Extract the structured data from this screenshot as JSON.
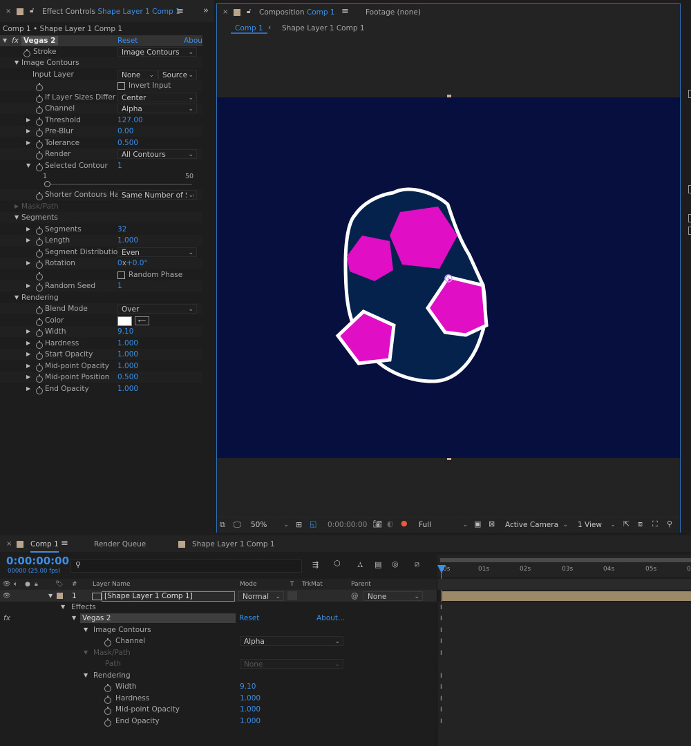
{
  "effect_panel": {
    "tab_title": "Effect Controls",
    "tab_layer": "Shape Layer 1 Comp 1",
    "breadcrumb": "Comp 1 • Shape Layer 1 Comp 1",
    "effect_name": "Vegas 2",
    "reset": "Reset",
    "about": "Abou",
    "rows": {
      "stroke": {
        "label": "Stroke",
        "value": "Image Contours"
      },
      "image_contours": "Image Contours",
      "input_layer": {
        "label": "Input Layer",
        "value": "None",
        "value2": "Source"
      },
      "invert_input": "Invert Input",
      "if_layer_sizes": {
        "label": "If Layer Sizes Differ",
        "value": "Center"
      },
      "channel": {
        "label": "Channel",
        "value": "Alpha"
      },
      "threshold": {
        "label": "Threshold",
        "value": "127.00"
      },
      "pre_blur": {
        "label": "Pre-Blur",
        "value": "0.00"
      },
      "tolerance": {
        "label": "Tolerance",
        "value": "0.500"
      },
      "render": {
        "label": "Render",
        "value": "All Contours"
      },
      "selected_contour": {
        "label": "Selected Contour",
        "value": "1",
        "slider_min": "1",
        "slider_max": "50"
      },
      "shorter_contours": {
        "label": "Shorter Contours Ha",
        "value": "Same Number of Se"
      },
      "mask_path": "Mask/Path",
      "segments_group": "Segments",
      "segments": {
        "label": "Segments",
        "value": "32"
      },
      "length": {
        "label": "Length",
        "value": "1.000"
      },
      "segment_distribution": {
        "label": "Segment Distribution",
        "value": "Even"
      },
      "rotation": {
        "label": "Rotation",
        "value_rev": "0",
        "value_x": "x",
        "value_deg": "+0.0°"
      },
      "random_phase": "Random Phase",
      "random_seed": {
        "label": "Random Seed",
        "value": "1"
      },
      "rendering_group": "Rendering",
      "blend_mode": {
        "label": "Blend Mode",
        "value": "Over"
      },
      "color": {
        "label": "Color"
      },
      "width": {
        "label": "Width",
        "value": "9.10"
      },
      "hardness": {
        "label": "Hardness",
        "value": "1.000"
      },
      "start_opacity": {
        "label": "Start Opacity",
        "value": "1.000"
      },
      "midpoint_opacity": {
        "label": "Mid-point Opacity",
        "value": "1.000"
      },
      "midpoint_position": {
        "label": "Mid-point Position",
        "value": "0.500"
      },
      "end_opacity": {
        "label": "End Opacity",
        "value": "1.000"
      }
    }
  },
  "comp_panel": {
    "tab_title": "Composition",
    "tab_comp": "Comp 1",
    "footage_tab": "Footage",
    "footage_value": "(none)",
    "nav_comp": "Comp 1",
    "nav_layer": "Shape Layer 1 Comp 1",
    "zoom": "50%",
    "timecode": "0:00:00:00",
    "resolution": "Full",
    "camera": "Active Camera",
    "views": "1 View",
    "colors": {
      "canvas": "#060f3e",
      "egg": "#04224c",
      "shapes": "#e00fc6"
    }
  },
  "timeline": {
    "tab_comp": "Comp 1",
    "tab_render_queue": "Render Queue",
    "tab_layer": "Shape Layer 1 Comp 1",
    "timecode": "0:00:00:00",
    "frames": "00000 (25.00 fps)",
    "search_placeholder": "",
    "col_number": "#",
    "col_layer_name": "Layer Name",
    "col_mode": "Mode",
    "col_t": "T",
    "col_trkmat": "TrkMat",
    "col_parent": "Parent",
    "layer": {
      "number": "1",
      "name": "[Shape Layer 1 Comp 1]",
      "mode": "Normal",
      "parent": "None"
    },
    "effects": "Effects",
    "effect_name": "Vegas 2",
    "reset": "Reset",
    "about": "About...",
    "image_contours": "Image Contours",
    "channel": {
      "label": "Channel",
      "value": "Alpha"
    },
    "mask_path": "Mask/Path",
    "path": {
      "label": "Path",
      "value": "None"
    },
    "rendering": "Rendering",
    "width": {
      "label": "Width",
      "value": "9.10"
    },
    "hardness": {
      "label": "Hardness",
      "value": "1.000"
    },
    "midpoint_opacity": {
      "label": "Mid-point Opacity",
      "value": "1.000"
    },
    "end_opacity": {
      "label": "End Opacity",
      "value": "1.000"
    },
    "ruler": [
      "0s",
      "01s",
      "02s",
      "03s",
      "04s",
      "05s",
      "0"
    ]
  }
}
